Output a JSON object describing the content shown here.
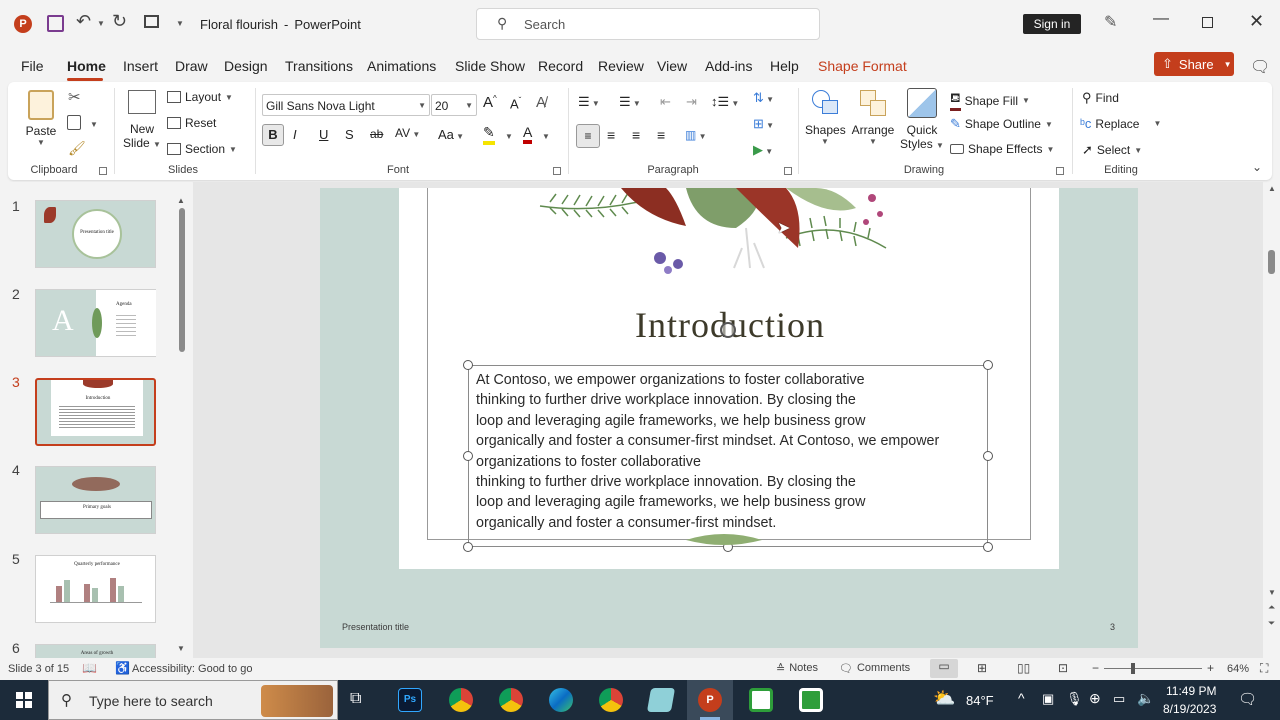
{
  "titlebar": {
    "doc_name": "Floral flourish",
    "separator": "-",
    "app_name": "PowerPoint",
    "search_placeholder": "Search",
    "sign_in": "Sign in"
  },
  "tabs": [
    "File",
    "Home",
    "Insert",
    "Draw",
    "Design",
    "Transitions",
    "Animations",
    "Slide Show",
    "Record",
    "Review",
    "View",
    "Add-ins",
    "Help",
    "Shape Format"
  ],
  "share_label": "Share",
  "ribbon": {
    "clipboard": {
      "paste": "Paste",
      "label": "Clipboard"
    },
    "slides": {
      "new_slide_1": "New",
      "new_slide_2": "Slide",
      "layout": "Layout",
      "reset": "Reset",
      "section": "Section",
      "label": "Slides"
    },
    "font": {
      "family": "Gill Sans Nova Light",
      "size": "20",
      "label": "Font"
    },
    "paragraph": {
      "label": "Paragraph"
    },
    "drawing": {
      "shapes": "Shapes",
      "arrange": "Arrange",
      "quick_1": "Quick",
      "quick_2": "Styles",
      "fill": "Shape Fill",
      "outline": "Shape Outline",
      "effects": "Shape Effects",
      "label": "Drawing"
    },
    "editing": {
      "find": "Find",
      "replace": "Replace",
      "select": "Select",
      "label": "Editing"
    }
  },
  "thumbnails": [
    {
      "num": "1",
      "title": "Presentation title"
    },
    {
      "num": "2",
      "title": "Agenda"
    },
    {
      "num": "3",
      "title": "Introduction"
    },
    {
      "num": "4",
      "title": "Primary goals"
    },
    {
      "num": "5",
      "title": "Quarterly performance"
    },
    {
      "num": "6",
      "title": "Areas of growth"
    }
  ],
  "slide": {
    "title": "Introduction",
    "body_lines": [
      "At Contoso, we empower organizations to foster collaborative",
      "thinking to further drive workplace innovation. By closing the",
      "loop and leveraging agile frameworks, we help business grow",
      "organically and foster a consumer-first mindset. At Contoso, we empower",
      "organizations to foster collaborative",
      "thinking to further drive workplace innovation. By closing the",
      "loop and leveraging agile frameworks, we help business grow",
      "organically and foster a consumer-first mindset."
    ],
    "footer": "Presentation title",
    "page_number": "3"
  },
  "status": {
    "slide_info": "Slide 3 of 15",
    "accessibility": "Accessibility: Good to go",
    "notes": "Notes",
    "comments": "Comments",
    "zoom": "64%"
  },
  "taskbar": {
    "search_placeholder": "Type here to search",
    "weather": "84°F",
    "time": "11:49 PM",
    "date": "8/19/2023"
  },
  "colors": {
    "accent": "#c43e1c",
    "shape_format": "#c43e1c",
    "slide_bg": "#c8d9d4"
  }
}
